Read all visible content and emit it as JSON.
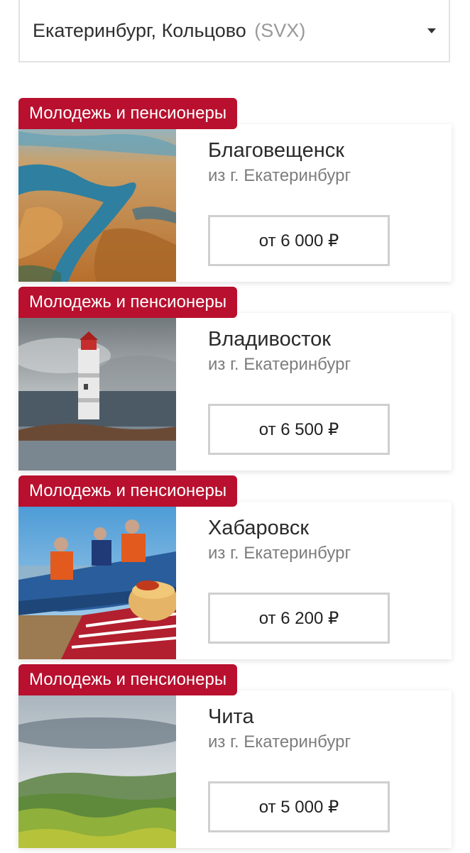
{
  "origin": {
    "city": "Екатеринбург, Кольцово",
    "code": "(SVX)"
  },
  "offers": [
    {
      "badge": "Молодежь и пенсионеры",
      "city": "Благовещенск",
      "from": "из г. Екатеринбург",
      "price": "от 6 000 ₽",
      "image": "river-delta-aerial"
    },
    {
      "badge": "Молодежь и пенсионеры",
      "city": "Владивосток",
      "from": "из г. Екатеринбург",
      "price": "от 6 500 ₽",
      "image": "lighthouse"
    },
    {
      "badge": "Молодежь и пенсионеры",
      "city": "Хабаровск",
      "from": "из г. Екатеринбург",
      "price": "от 6 200 ₽",
      "image": "fishermen-boat-and-pancakes"
    },
    {
      "badge": "Молодежь и пенсионеры",
      "city": "Чита",
      "from": "из г. Екатеринбург",
      "price": "от 5 000 ₽",
      "image": "green-hills-landscape"
    }
  ],
  "colors": {
    "badge": "#b8102e",
    "border": "#cfcfcf"
  }
}
